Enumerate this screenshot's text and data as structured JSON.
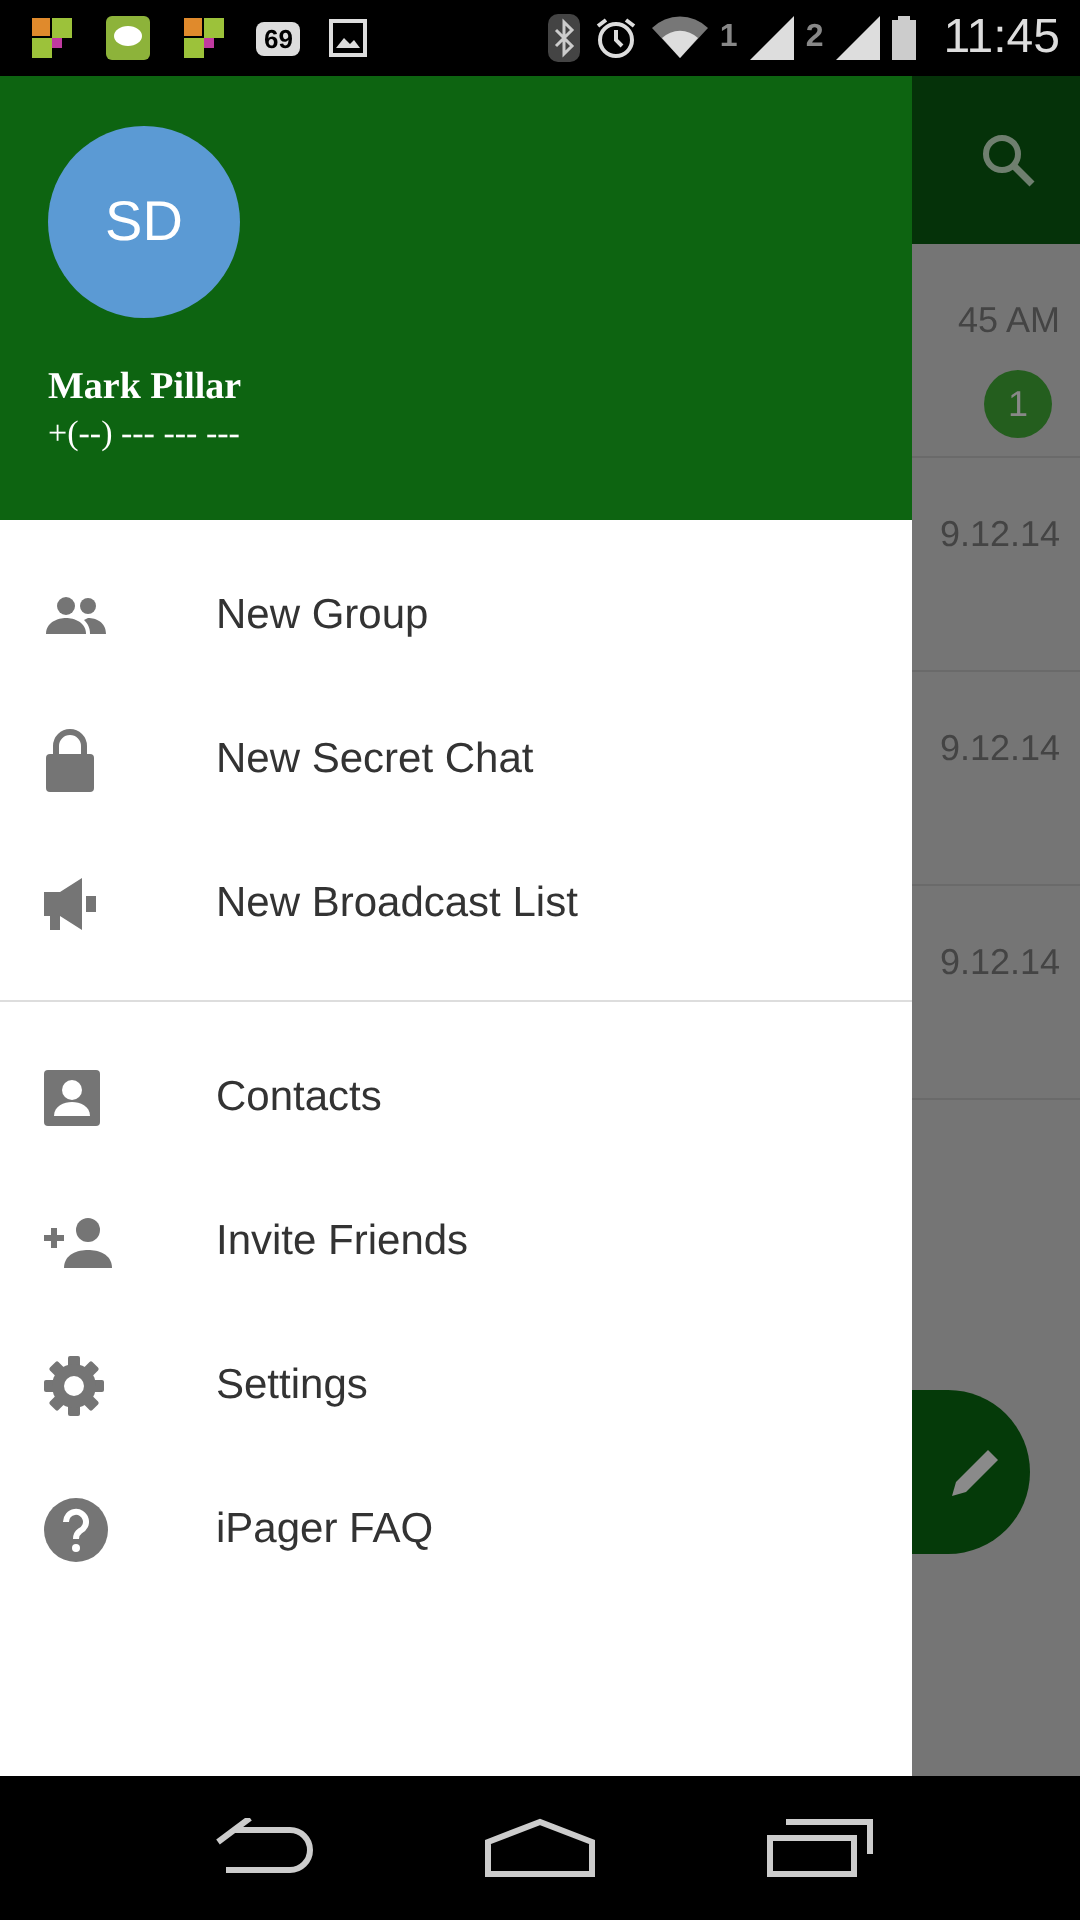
{
  "status_bar": {
    "battery_badge": "69",
    "sim_1": "1",
    "sim_2": "2",
    "time": "11:45"
  },
  "drawer": {
    "avatar_initials": "SD",
    "name": "Mark Pillar",
    "phone": "+(--) --- --- ---",
    "groups": [
      [
        {
          "label": "New Group",
          "kind": "group"
        },
        {
          "label": "New Secret Chat",
          "kind": "lock"
        },
        {
          "label": "New Broadcast List",
          "kind": "megaphone"
        }
      ],
      [
        {
          "label": "Contacts",
          "kind": "contact"
        },
        {
          "label": "Invite Friends",
          "kind": "add-person"
        },
        {
          "label": "Settings",
          "kind": "gear"
        },
        {
          "label": "iPager FAQ",
          "kind": "help"
        }
      ]
    ]
  },
  "chat_list": [
    {
      "time": "45 AM",
      "unread": "1"
    },
    {
      "time": "9.12.14"
    },
    {
      "time": "9.12.14"
    },
    {
      "time": "9.12.14"
    }
  ]
}
